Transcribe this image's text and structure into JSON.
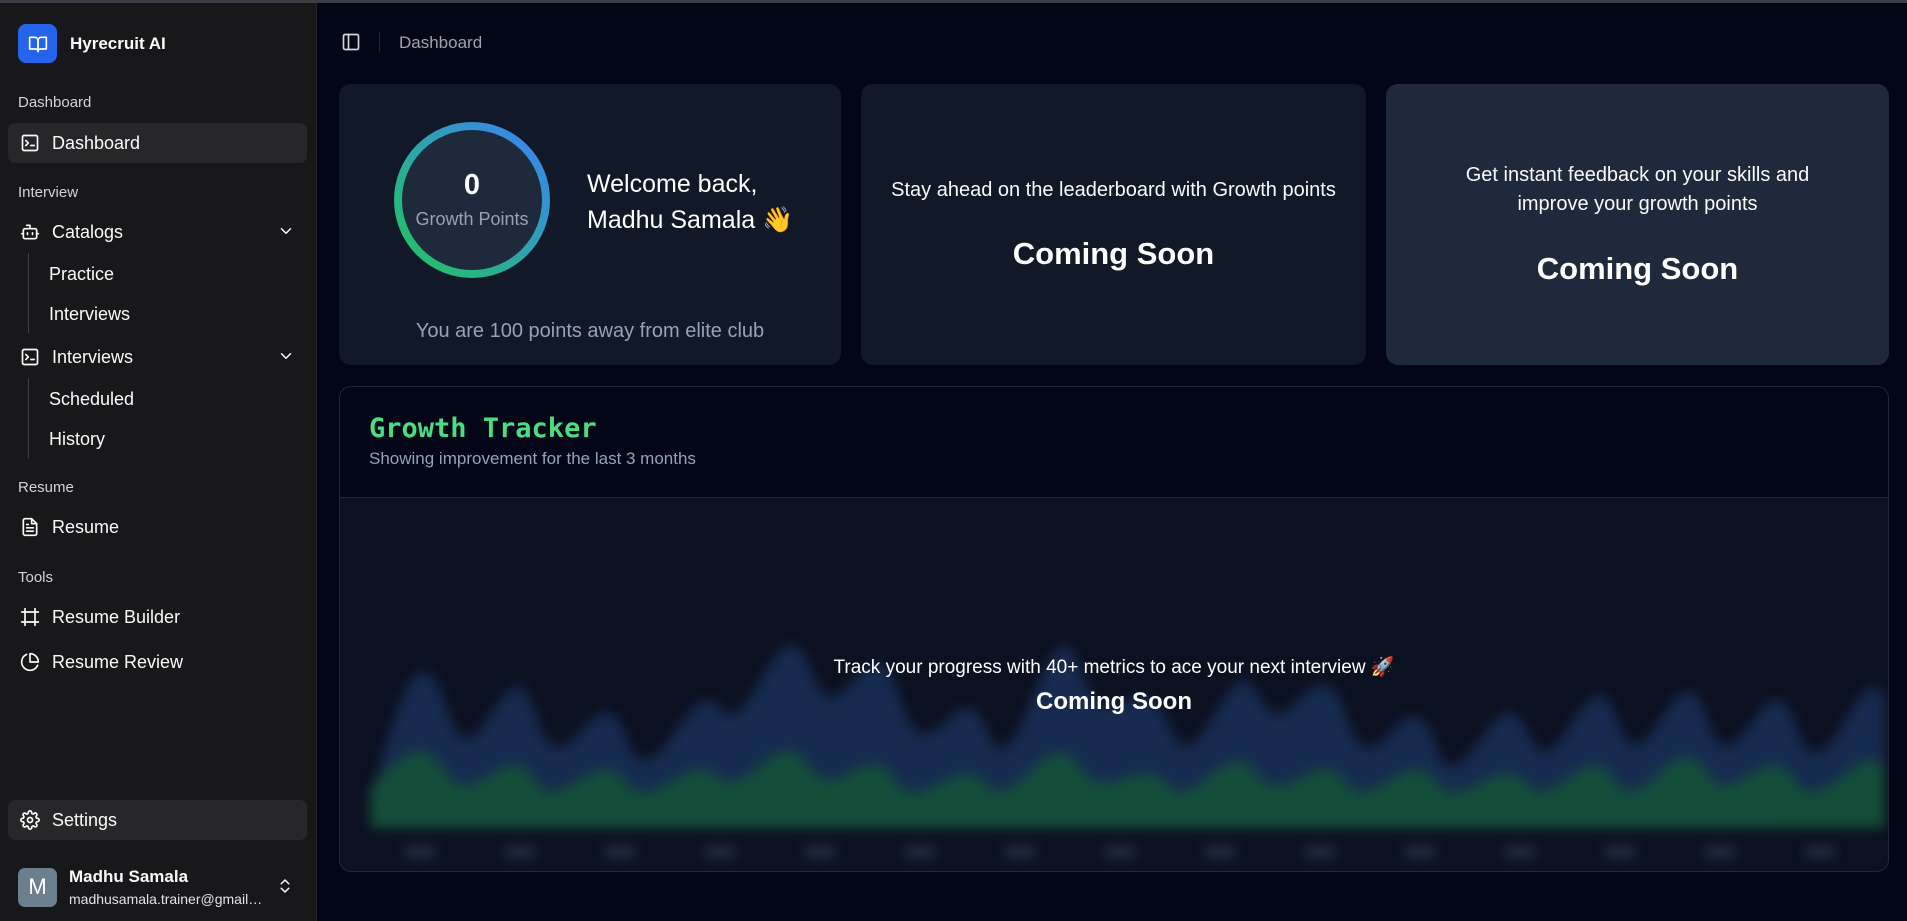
{
  "brand": {
    "name": "Hyrecruit AI"
  },
  "sidebar": {
    "sections": {
      "dashboard": "Dashboard",
      "interview": "Interview",
      "resume": "Resume",
      "tools": "Tools"
    },
    "items": {
      "dashboard": "Dashboard",
      "catalogs": "Catalogs",
      "practice": "Practice",
      "interviews_sub": "Interviews",
      "interviews": "Interviews",
      "scheduled": "Scheduled",
      "history": "History",
      "resume": "Resume",
      "resume_builder": "Resume Builder",
      "resume_review": "Resume Review",
      "settings": "Settings"
    }
  },
  "user": {
    "initial": "M",
    "name": "Madhu Samala",
    "email": "madhusamala.trainer@gmail.com"
  },
  "header": {
    "breadcrumb": "Dashboard"
  },
  "cards": {
    "growth": {
      "points": "0",
      "points_label": "Growth Points",
      "welcome_line1": "Welcome back,",
      "welcome_line2": "Madhu Samala 👋",
      "elite_msg": "You are 100 points away from elite club"
    },
    "leaderboard": {
      "message": "Stay ahead on the leaderboard with Growth points",
      "status": "Coming Soon"
    },
    "feedback": {
      "message_line1": "Get instant feedback on your skills and",
      "message_line2": "improve your growth points",
      "status": "Coming Soon"
    }
  },
  "tracker": {
    "title": "Growth Tracker",
    "subtitle": "Showing improvement for the last 3 months",
    "overlay_message": "Track your progress with 40+ metrics to ace your next interview 🚀",
    "overlay_status": "Coming Soon"
  },
  "colors": {
    "accent": "#2563eb",
    "green": "#4ade80",
    "ring_start": "#22c55e",
    "ring_end": "#3b82f6"
  }
}
